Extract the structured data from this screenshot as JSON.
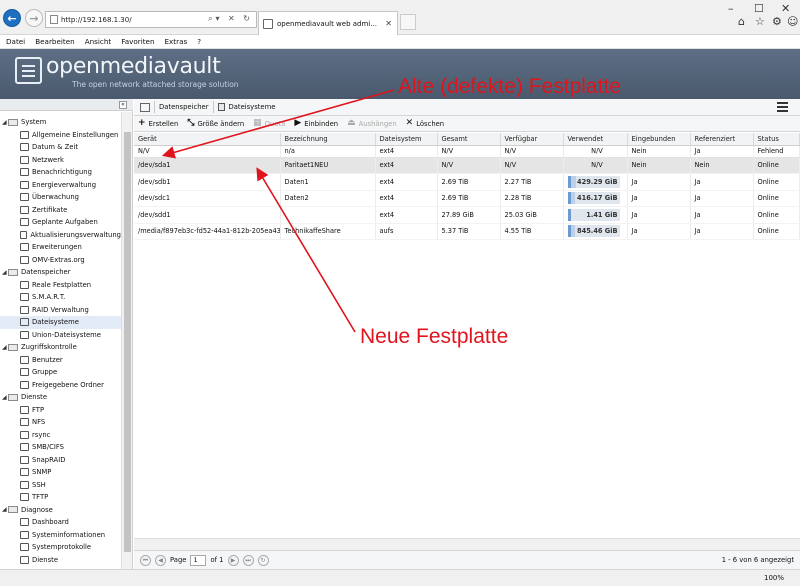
{
  "browser": {
    "url": "http://192.168.1.30/",
    "tab_title": "openmediavault web admi...",
    "zoom": "100%"
  },
  "menubar": [
    "Datei",
    "Bearbeiten",
    "Ansicht",
    "Favoriten",
    "Extras",
    "?"
  ],
  "app": {
    "title": "openmediavault",
    "subtitle": "The open network attached storage solution"
  },
  "annotations": {
    "old_disk": "Alte (defekte) Festplatte",
    "new_disk": "Neue Festplatte"
  },
  "colors": {
    "accent": "#1e6fc0",
    "header": "#4f5e73",
    "annotation": "#e0141c",
    "selected_row": "#e5e5e5"
  },
  "sidebar": {
    "groups": [
      {
        "label": "System",
        "items": [
          "Allgemeine Einstellungen",
          "Datum & Zeit",
          "Netzwerk",
          "Benachrichtigung",
          "Energieverwaltung",
          "Überwachung",
          "Zertifikate",
          "Geplante Aufgaben",
          "Aktualisierungsverwaltung",
          "Erweiterungen",
          "OMV-Extras.org"
        ]
      },
      {
        "label": "Datenspeicher",
        "items": [
          "Reale Festplatten",
          "S.M.A.R.T.",
          "RAID Verwaltung",
          "Dateisysteme",
          "Union-Dateisysteme"
        ]
      },
      {
        "label": "Zugriffskontrolle",
        "items": [
          "Benutzer",
          "Gruppe",
          "Freigegebene Ordner"
        ]
      },
      {
        "label": "Dienste",
        "items": [
          "FTP",
          "NFS",
          "rsync",
          "SMB/CIFS",
          "SnapRAID",
          "SNMP",
          "SSH",
          "TFTP"
        ]
      },
      {
        "label": "Diagnose",
        "items": [
          "Dashboard",
          "Systeminformationen",
          "Systemprotokolle",
          "Dienste"
        ]
      }
    ]
  },
  "breadcrumb": [
    "Datenspeicher",
    "Dateisysteme"
  ],
  "toolbar": {
    "create": "Erstellen",
    "resize": "Größe ändern",
    "quota": "Quota",
    "mount": "Einbinden",
    "unmount": "Aushängen",
    "delete": "Löschen"
  },
  "table": {
    "columns": [
      "Gerät",
      "Bezeichnung",
      "Dateisystem",
      "Gesamt",
      "Verfügbar",
      "Verwendet",
      "Eingebunden",
      "Referenziert",
      "Status"
    ],
    "rows": [
      {
        "device": "N/V",
        "label": "n/a",
        "fs": "ext4",
        "total": "N/V",
        "avail": "N/V",
        "used": "N/V",
        "mounted": "Nein",
        "ref": "Ja",
        "status": "Fehlend",
        "bar": null
      },
      {
        "device": "/dev/sda1",
        "label": "Paritaet1NEU",
        "fs": "ext4",
        "total": "N/V",
        "avail": "N/V",
        "used": "N/V",
        "mounted": "Nein",
        "ref": "Nein",
        "status": "Online",
        "bar": null
      },
      {
        "device": "/dev/sdb1",
        "label": "Daten1",
        "fs": "ext4",
        "total": "2.69 TiB",
        "avail": "2.27 TiB",
        "used": "429.29 GiB",
        "mounted": "Ja",
        "ref": "Ja",
        "status": "Online",
        "bar": 0.16
      },
      {
        "device": "/dev/sdc1",
        "label": "Daten2",
        "fs": "ext4",
        "total": "2.69 TiB",
        "avail": "2.28 TiB",
        "used": "416.17 GiB",
        "mounted": "Ja",
        "ref": "Ja",
        "status": "Online",
        "bar": 0.15
      },
      {
        "device": "/dev/sdd1",
        "label": "",
        "fs": "ext4",
        "total": "27.89 GiB",
        "avail": "25.03 GiB",
        "used": "1.41 GiB",
        "mounted": "Ja",
        "ref": "Ja",
        "status": "Online",
        "bar": 0.05
      },
      {
        "device": "/media/f897eb3c-fd52-44a1-812b-205ea43...",
        "label": "TechnikaffeShare",
        "fs": "aufs",
        "total": "5.37 TiB",
        "avail": "4.55 TiB",
        "used": "845.46 GiB",
        "mounted": "Ja",
        "ref": "Ja",
        "status": "Online",
        "bar": 0.15
      }
    ]
  },
  "pager": {
    "page_label": "Page",
    "page": "1",
    "of": "of 1",
    "info": "1 - 6 von 6 angezeigt"
  }
}
